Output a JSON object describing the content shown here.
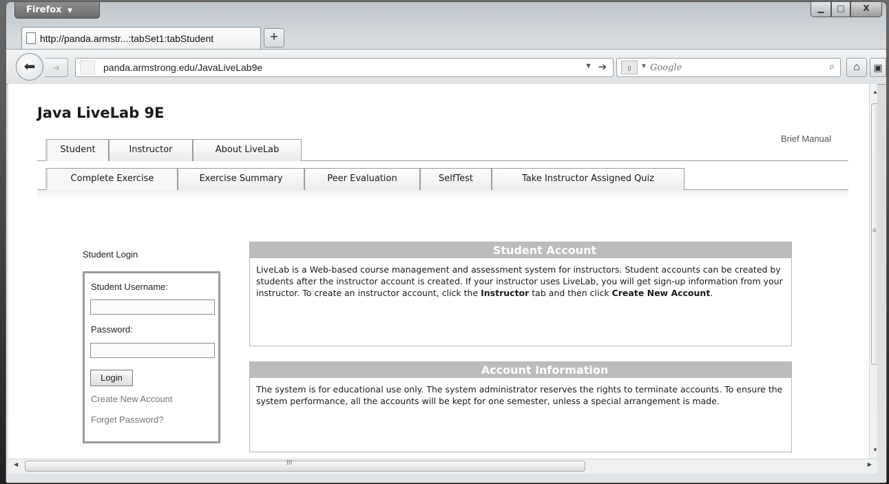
{
  "browser": {
    "menu_button": "Firefox",
    "window_controls": {
      "minimize": "▁",
      "maximize": "□",
      "close": "X"
    },
    "tab_title": "http://panda.armstr...:tabSet1:tabStudent",
    "new_tab": "+",
    "address": "panda.armstrong.edu/JavaLiveLab9e",
    "search_placeholder": "Google"
  },
  "page": {
    "title": "Java LiveLab 9E",
    "brief_manual": "Brief Manual",
    "main_tabs": [
      "Student",
      "Instructor",
      "About LiveLab"
    ],
    "sub_tabs": [
      "Complete Exercise",
      "Exercise Summary",
      "Peer Evaluation",
      "SelfTest",
      "Take Instructor Assigned Quiz"
    ],
    "login": {
      "heading": "Student Login",
      "username_label": "Student Username:",
      "password_label": "Password:",
      "button": "Login",
      "create_link": "Create New Account",
      "forget_link": "Forget Password?"
    },
    "panels": {
      "student_account": {
        "title": "Student Account",
        "text_a": "LiveLab is a Web-based course management and assessment system for instructors. Student accounts can be created by students after the instructor account is created. If your instructor uses LiveLab, you will get sign-up information from your instructor. To create an instructor account, click the ",
        "bold_a": "Instructor",
        "text_b": " tab and then click ",
        "bold_b": "Create New Account",
        "text_c": "."
      },
      "account_information": {
        "title": "Account Information",
        "text": "The system is for educational use only. The system administrator reserves the rights to terminate accounts. To ensure the system performance, all the accounts will be kept for one semester, unless a special arrangement is made."
      }
    },
    "scrollbar_grip": "III",
    "vscroll_grip": "≡"
  }
}
